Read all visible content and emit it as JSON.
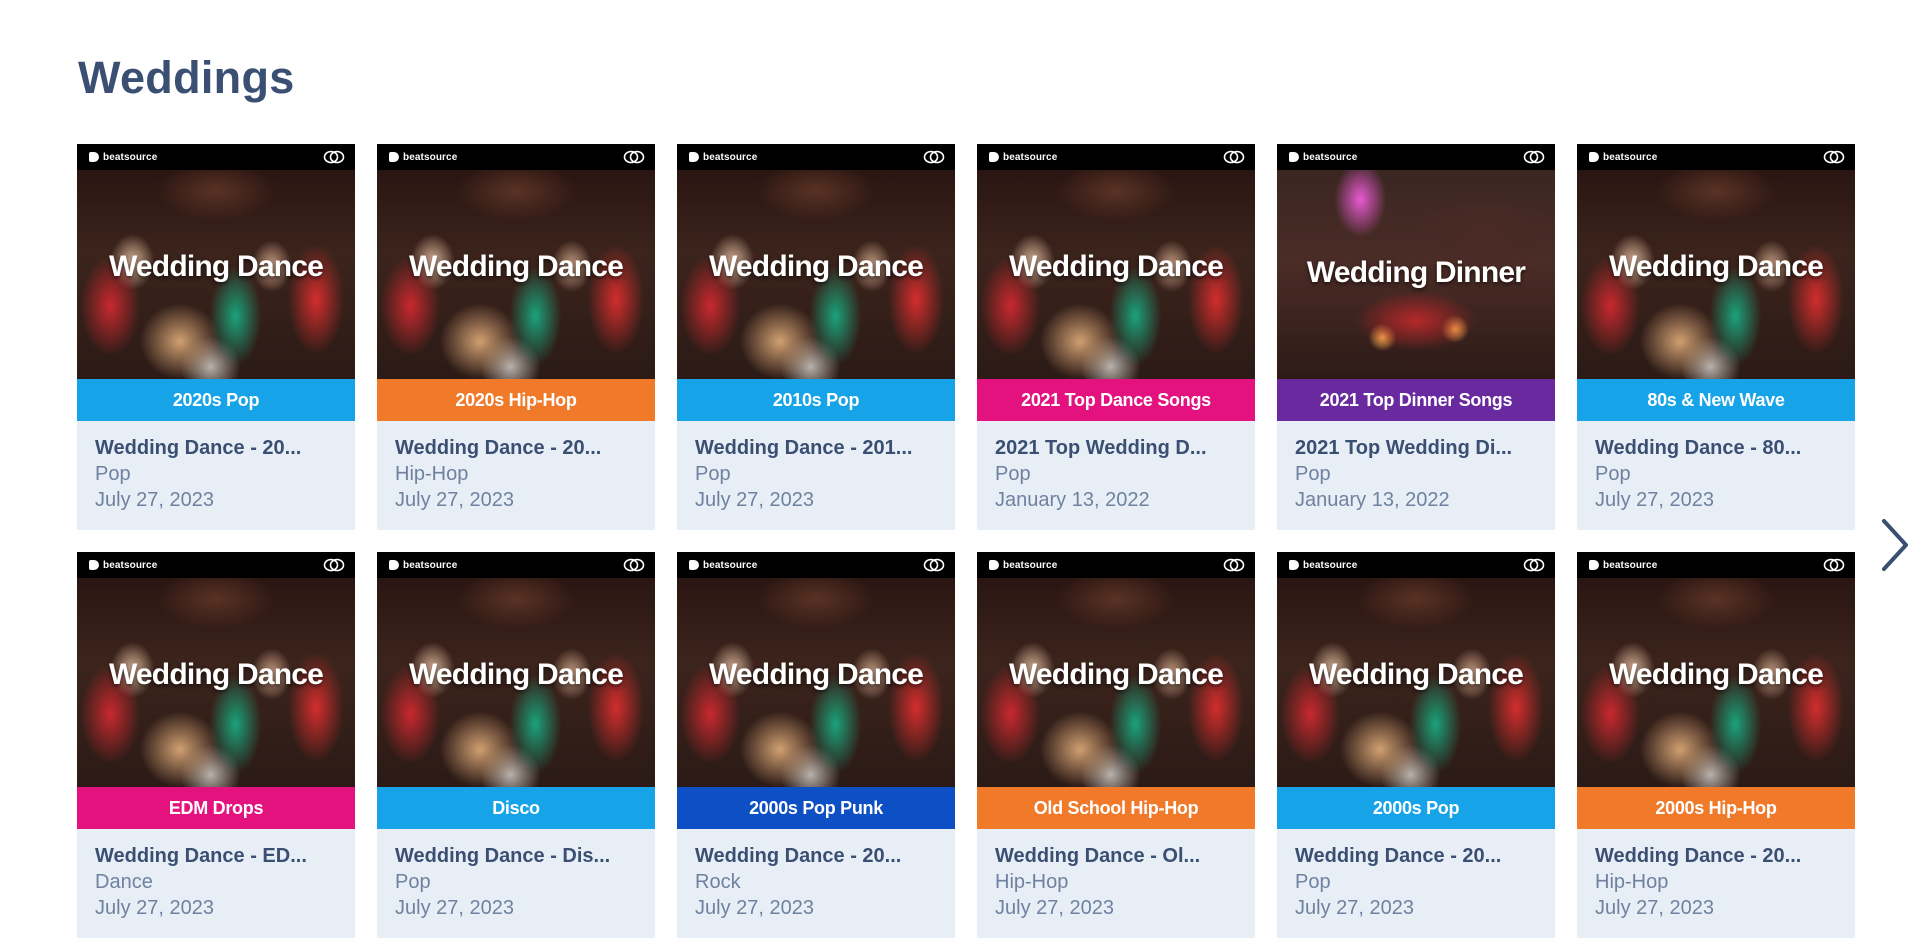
{
  "section": {
    "title": "Weddings"
  },
  "brand": {
    "name": "beatsource"
  },
  "colors": {
    "blue": "#17a3e8",
    "orange": "#f07a2a",
    "magenta": "#e3127f",
    "purple": "#6a2a9f",
    "navy_blue": "#0d4fc4",
    "title_text": "#3a4f72",
    "meta_text": "#6e82a0",
    "card_bg": "#e8eef6"
  },
  "cards": [
    {
      "art_title": "Wedding Dance",
      "art_band": "2020s Pop",
      "band_color": "#17a3e8",
      "photo": "dance",
      "title": "Wedding Dance - 20...",
      "genre": "Pop",
      "date": "July 27, 2023"
    },
    {
      "art_title": "Wedding Dance",
      "art_band": "2020s Hip-Hop",
      "band_color": "#f07a2a",
      "photo": "dance",
      "title": "Wedding Dance - 20...",
      "genre": "Hip-Hop",
      "date": "July 27, 2023"
    },
    {
      "art_title": "Wedding Dance",
      "art_band": "2010s Pop",
      "band_color": "#17a3e8",
      "photo": "dance",
      "title": "Wedding Dance - 201...",
      "genre": "Pop",
      "date": "July 27, 2023"
    },
    {
      "art_title": "Wedding Dance",
      "art_band": "2021 Top Dance Songs",
      "band_color": "#e3127f",
      "photo": "dance",
      "title": "2021 Top Wedding D...",
      "genre": "Pop",
      "date": "January 13, 2022"
    },
    {
      "art_title": "Wedding Dinner",
      "art_band": "2021 Top Dinner Songs",
      "band_color": "#6a2a9f",
      "photo": "dinner",
      "title": "2021 Top Wedding Di...",
      "genre": "Pop",
      "date": "January 13, 2022"
    },
    {
      "art_title": "Wedding Dance",
      "art_band": "80s & New Wave",
      "band_color": "#17a3e8",
      "photo": "dance",
      "title": "Wedding Dance - 80...",
      "genre": "Pop",
      "date": "July 27, 2023"
    },
    {
      "art_title": "Wedding Dance",
      "art_band": "EDM Drops",
      "band_color": "#e3127f",
      "photo": "dance",
      "title": "Wedding Dance - ED...",
      "genre": "Dance",
      "date": "July 27, 2023"
    },
    {
      "art_title": "Wedding Dance",
      "art_band": "Disco",
      "band_color": "#17a3e8",
      "photo": "dance",
      "title": "Wedding Dance - Dis...",
      "genre": "Pop",
      "date": "July 27, 2023"
    },
    {
      "art_title": "Wedding Dance",
      "art_band": "2000s Pop Punk",
      "band_color": "#0d4fc4",
      "photo": "dance",
      "title": "Wedding Dance - 20...",
      "genre": "Rock",
      "date": "July 27, 2023"
    },
    {
      "art_title": "Wedding Dance",
      "art_band": "Old School Hip-Hop",
      "band_color": "#f07a2a",
      "photo": "dance",
      "title": "Wedding Dance - Ol...",
      "genre": "Hip-Hop",
      "date": "July 27, 2023"
    },
    {
      "art_title": "Wedding Dance",
      "art_band": "2000s Pop",
      "band_color": "#17a3e8",
      "photo": "dance",
      "title": "Wedding Dance - 20...",
      "genre": "Pop",
      "date": "July 27, 2023"
    },
    {
      "art_title": "Wedding Dance",
      "art_band": "2000s Hip-Hop",
      "band_color": "#f07a2a",
      "photo": "dance",
      "title": "Wedding Dance - 20...",
      "genre": "Hip-Hop",
      "date": "July 27, 2023"
    }
  ],
  "navigation": {
    "next_icon": "chevron-right-icon"
  }
}
